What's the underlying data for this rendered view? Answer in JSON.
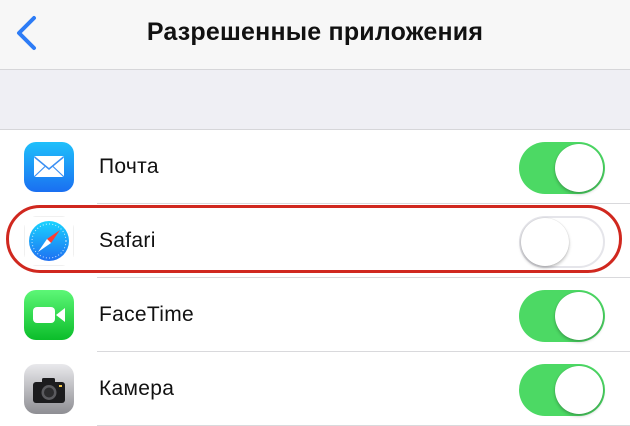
{
  "nav": {
    "title": "Разрешенные приложения",
    "back_icon": "chevron-left-icon",
    "accent_color": "#2d7cf6"
  },
  "apps": [
    {
      "id": "mail",
      "label": "Почта",
      "icon": "mail-icon",
      "enabled": true
    },
    {
      "id": "safari",
      "label": "Safari",
      "icon": "safari-icon",
      "enabled": false,
      "highlighted": true
    },
    {
      "id": "facetime",
      "label": "FaceTime",
      "icon": "facetime-icon",
      "enabled": true
    },
    {
      "id": "camera",
      "label": "Камера",
      "icon": "camera-icon",
      "enabled": true
    }
  ],
  "colors": {
    "toggle_on": "#4cd964",
    "highlight_outline": "#d0281f"
  }
}
